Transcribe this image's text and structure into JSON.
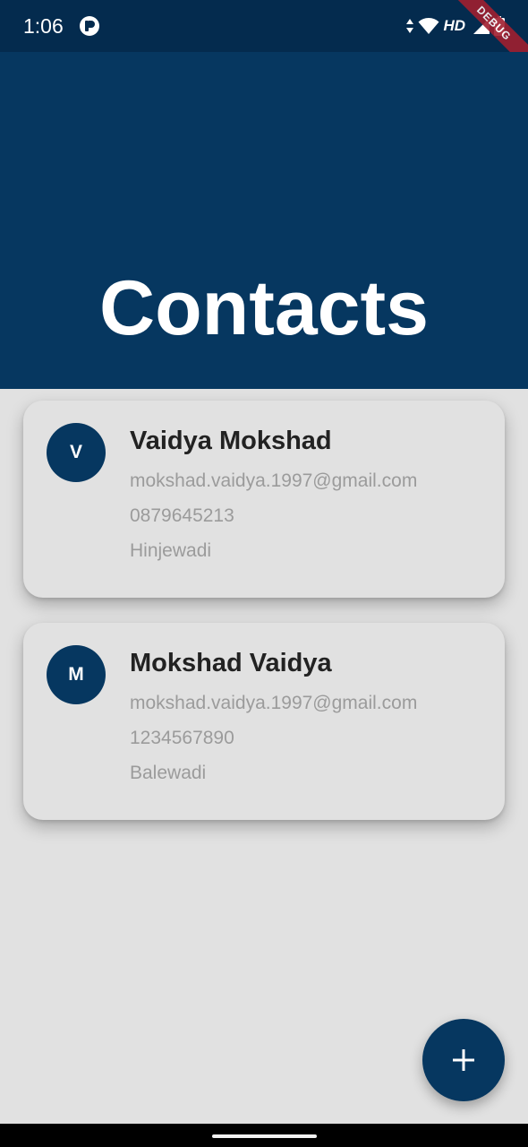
{
  "status_bar": {
    "time": "1:06",
    "network_label": "HD",
    "icons": [
      "app-notification-icon",
      "data-arrows-icon",
      "wifi-icon",
      "cell-signal-icon",
      "battery-icon"
    ]
  },
  "debug_banner": "DEBUG",
  "app_bar": {
    "title": "Contacts",
    "background_color": "#063760"
  },
  "contacts": [
    {
      "initial": "V",
      "name": "Vaidya Mokshad",
      "email": "mokshad.vaidya.1997@gmail.com",
      "phone": "0879645213",
      "location": "Hinjewadi"
    },
    {
      "initial": "M",
      "name": "Mokshad Vaidya",
      "email": "mokshad.vaidya.1997@gmail.com",
      "phone": "1234567890",
      "location": "Balewadi"
    }
  ],
  "fab": {
    "icon": "plus-icon"
  },
  "colors": {
    "primary": "#063760",
    "status_bar": "#042b4e",
    "background": "#e1e1e1",
    "secondary_text": "#9b9b9b",
    "debug_ribbon": "#a01f2f"
  }
}
